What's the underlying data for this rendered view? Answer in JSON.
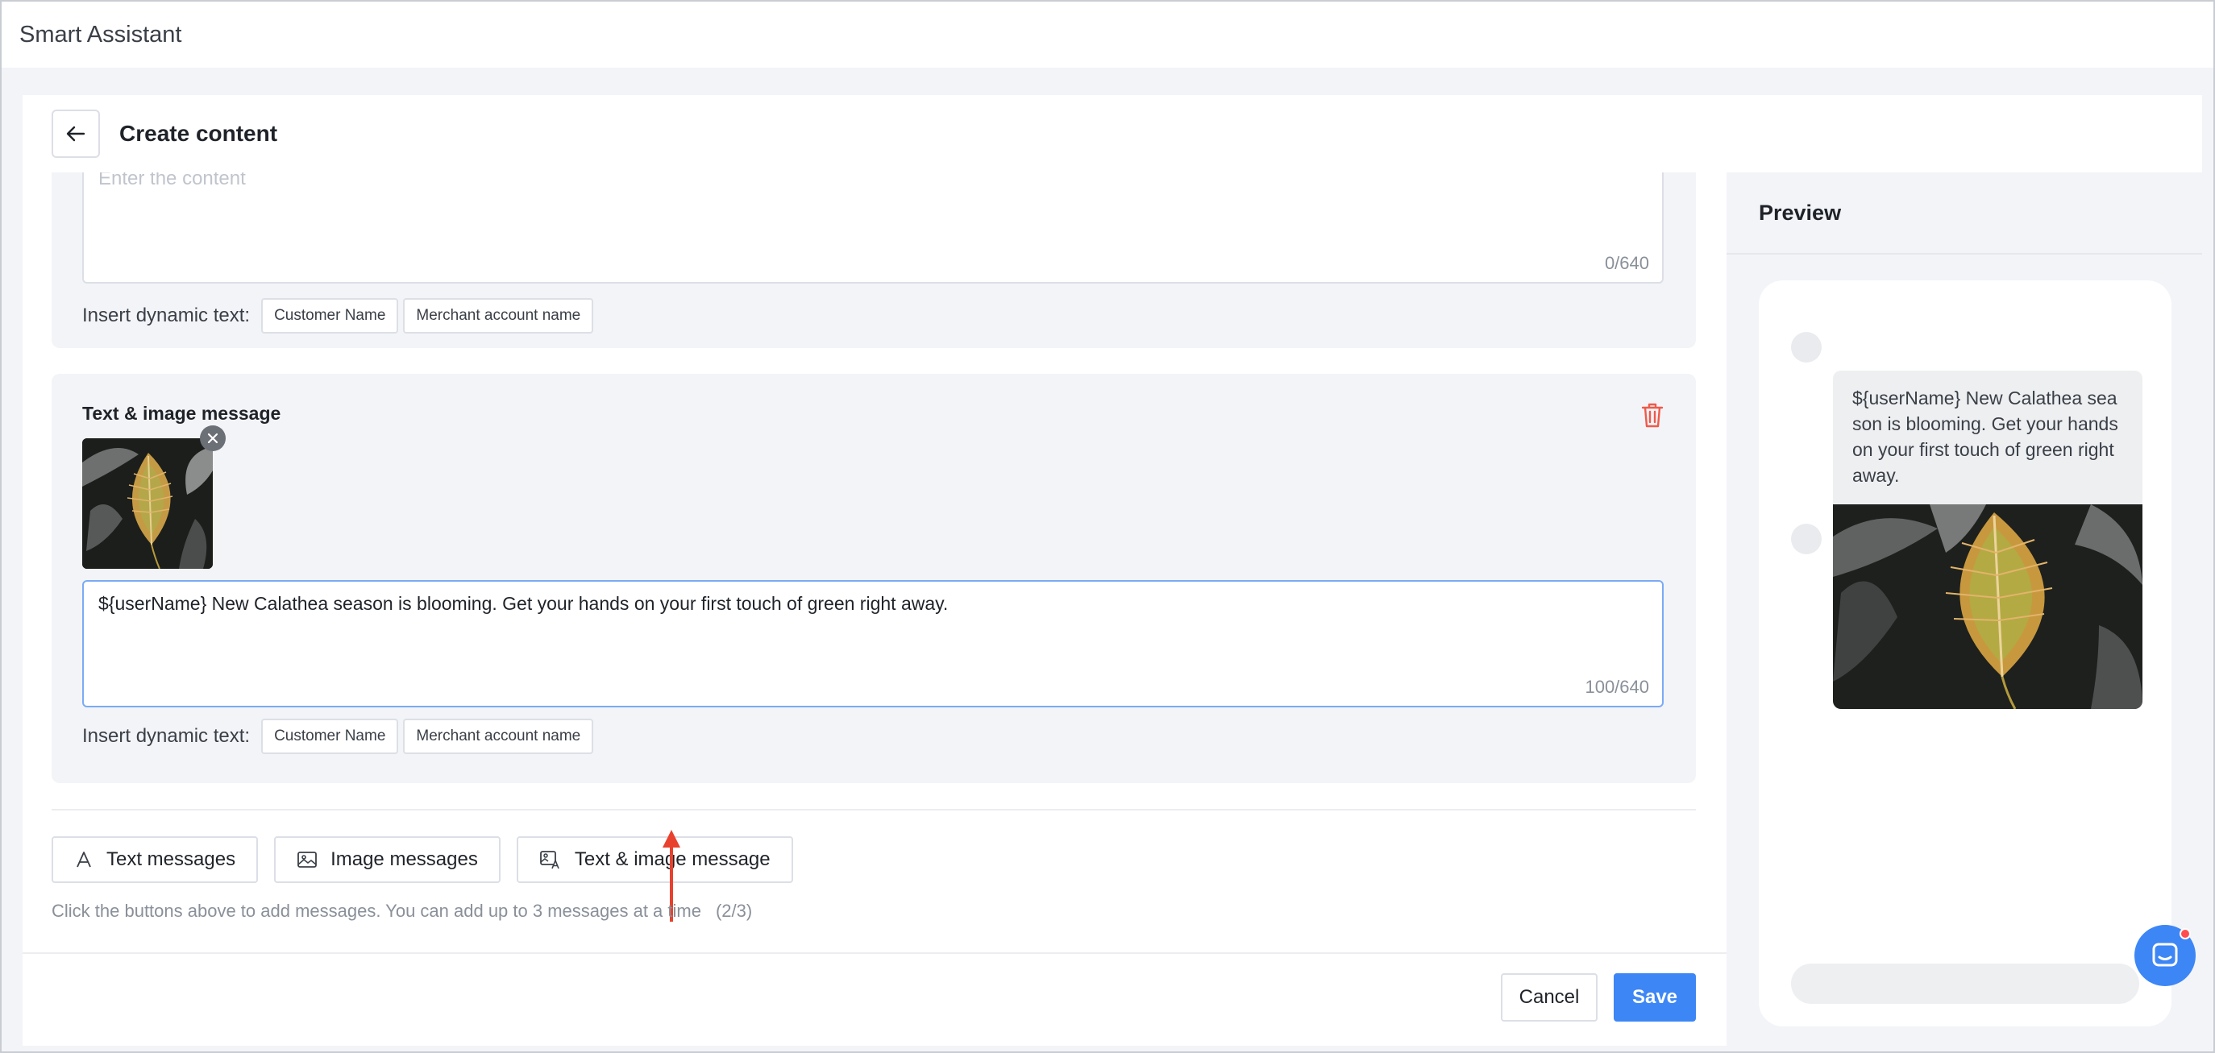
{
  "app": {
    "title": "Smart Assistant"
  },
  "page": {
    "title": "Create content"
  },
  "message_blocks": [
    {
      "type": "text",
      "placeholder": "Enter the content",
      "counter": "0/640",
      "dynamic_label": "Insert dynamic text:",
      "tags": [
        "Customer Name",
        "Merchant account name"
      ]
    },
    {
      "type": "text-image",
      "title": "Text & image message",
      "text": "${userName} New Calathea season is blooming. Get your hands on your first touch of green right away.",
      "counter": "100/640",
      "dynamic_label": "Insert dynamic text:",
      "tags": [
        "Customer Name",
        "Merchant account name"
      ]
    }
  ],
  "add_buttons": [
    {
      "label": "Text messages",
      "icon": "text-icon"
    },
    {
      "label": "Image messages",
      "icon": "image-icon"
    },
    {
      "label": "Text & image message",
      "icon": "text-image-icon"
    }
  ],
  "hint": {
    "text": "Click the buttons above to add messages. You can add up to 3 messages at a time",
    "count": "(2/3)"
  },
  "footer": {
    "cancel": "Cancel",
    "save": "Save"
  },
  "preview": {
    "title": "Preview",
    "bubble_text": "${userName} New Calathea season is blooming. Get your hands on your first touch of green right away."
  },
  "colors": {
    "primary": "#3d86f5",
    "danger": "#f05a4a",
    "annotation_arrow": "#e8412d"
  }
}
